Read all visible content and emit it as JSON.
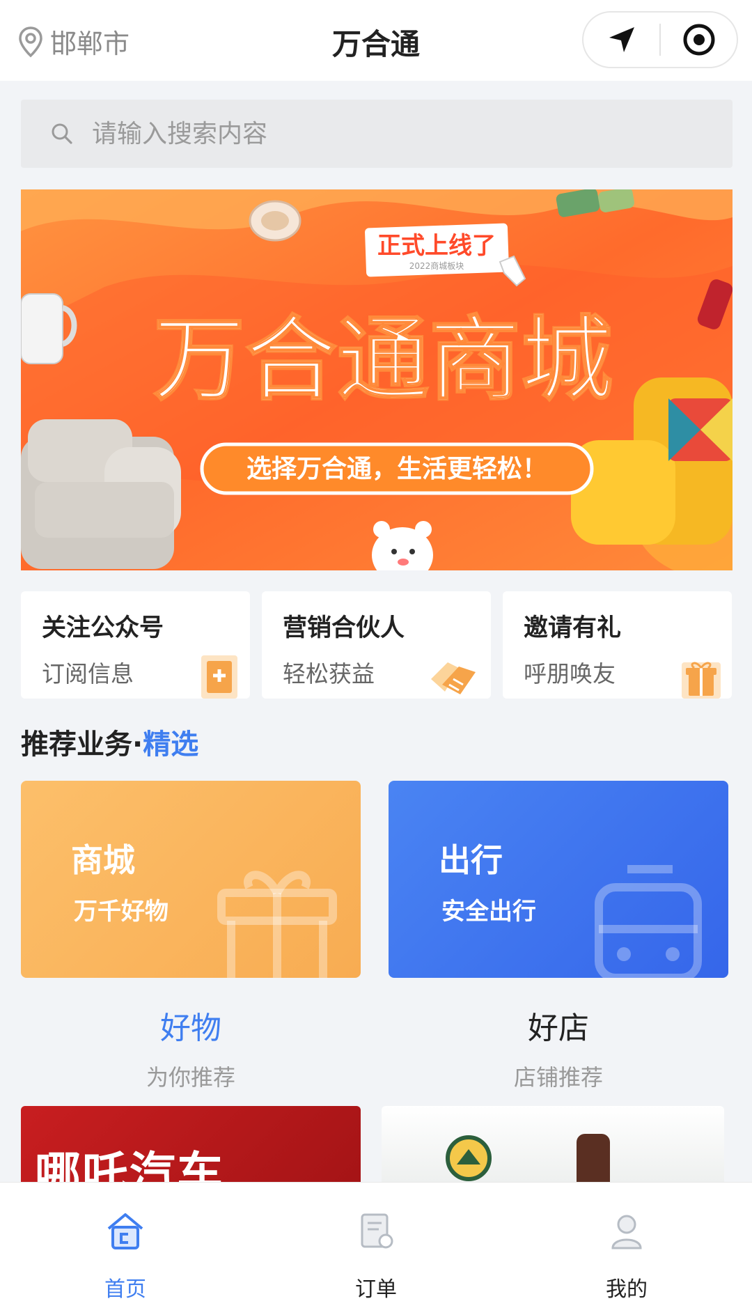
{
  "header": {
    "city": "邯郸市",
    "title": "万合通"
  },
  "search": {
    "placeholder": "请输入搜索内容"
  },
  "banner": {
    "title": "万合通商城",
    "tag": "正式上线了",
    "tag_sub": "2022商城板块",
    "slogan": "选择万合通，生活更轻松！"
  },
  "quick_links": [
    {
      "title": "关注公众号",
      "subtitle": "订阅信息"
    },
    {
      "title": "营销合伙人",
      "subtitle": "轻松获益"
    },
    {
      "title": "邀请有礼",
      "subtitle": "呼朋唤友"
    }
  ],
  "recommend": {
    "title": "推荐业务·",
    "highlight": "精选"
  },
  "cards": [
    {
      "title": "商城",
      "subtitle": "万千好物"
    },
    {
      "title": "出行",
      "subtitle": "安全出行"
    }
  ],
  "subsections": [
    {
      "title": "好物",
      "subtitle": "为你推荐"
    },
    {
      "title": "好店",
      "subtitle": "店铺推荐"
    }
  ],
  "product_preview": {
    "left_text": "哪吒汽车"
  },
  "tabs": [
    {
      "label": "首页"
    },
    {
      "label": "订单"
    },
    {
      "label": "我的"
    }
  ],
  "colors": {
    "accent": "#3f7ef0",
    "card_orange": "#f9b35c",
    "card_blue": "#3f72f0",
    "banner_orange": "#ff7a30"
  }
}
